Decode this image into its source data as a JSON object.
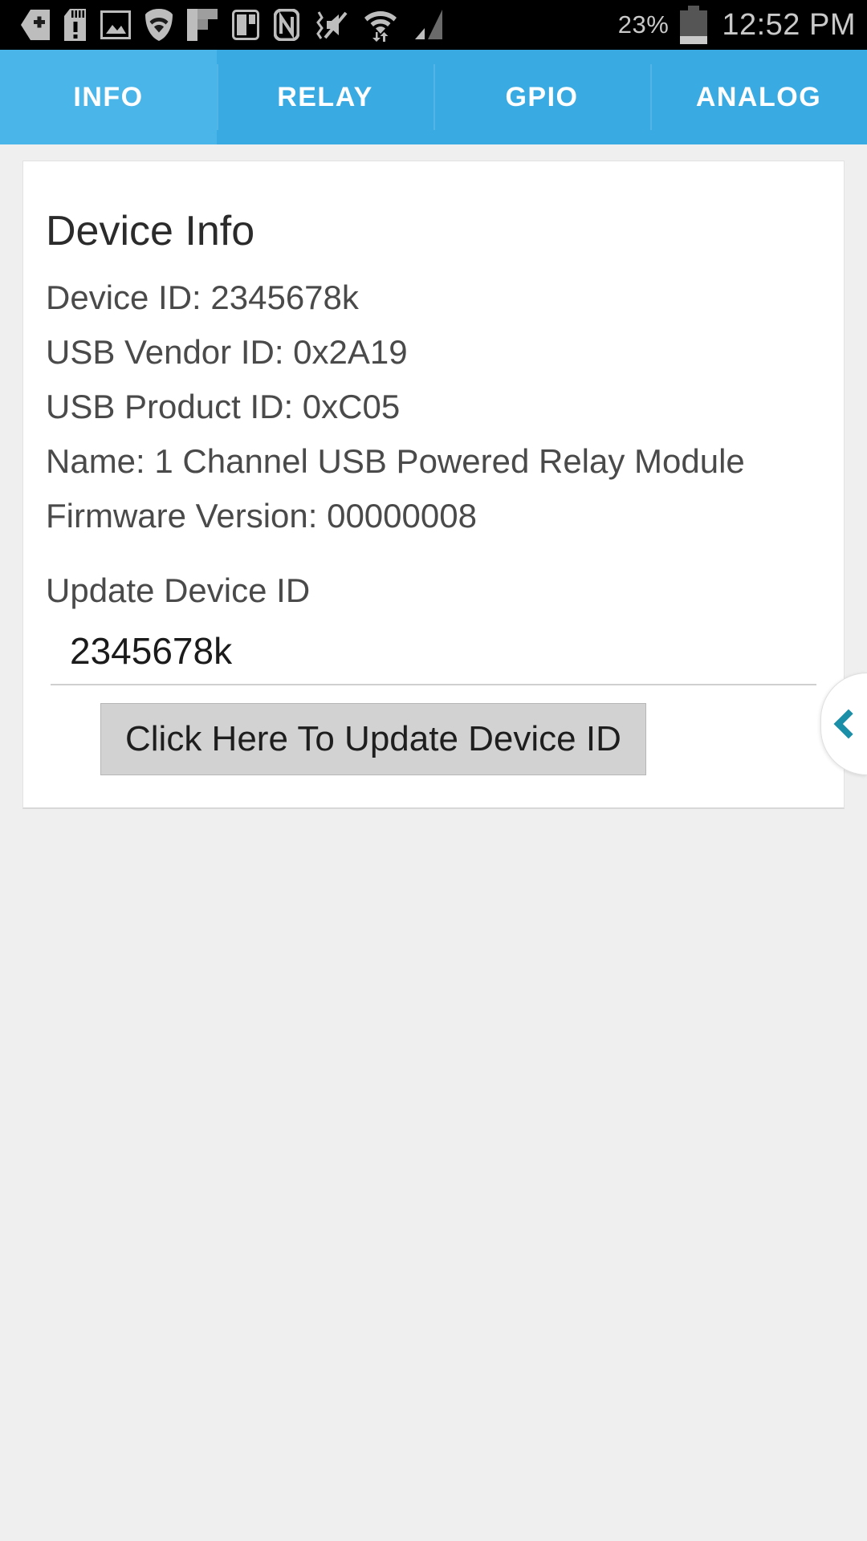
{
  "status_bar": {
    "icons": [
      "back-plus-icon",
      "sd-card-warning-icon",
      "image-icon",
      "wifi-shield-icon",
      "flipboard-icon",
      "split-screen-icon",
      "nfc-icon",
      "sound-muted-vibrate-icon",
      "wifi-data-transfer-icon",
      "cellular-signal-icon"
    ],
    "battery_percent": "23%",
    "battery_icon": "battery-icon",
    "time": "12:52 PM",
    "text_color": "#c9c9c9",
    "background": "#000000"
  },
  "tabs": {
    "active_index": 0,
    "active_color": "#4ab5e8",
    "inactive_color": "#3aabe2",
    "items": [
      {
        "label": "INFO"
      },
      {
        "label": "RELAY"
      },
      {
        "label": "GPIO"
      },
      {
        "label": "ANALOG"
      }
    ]
  },
  "card": {
    "title": "Device Info",
    "info_lines": [
      "Device ID: 2345678k",
      "USB Vendor ID: 0x2A19",
      "USB Product ID: 0xC05",
      "Name: 1 Channel USB Powered Relay Module",
      "Firmware Version: 00000008"
    ],
    "update_label": "Update Device ID",
    "device_id_input": {
      "value": "2345678k",
      "placeholder": "2345678k"
    },
    "update_button": "Click Here To Update Device ID"
  },
  "side_tab": {
    "icon": "chevron-left-icon",
    "accent_color": "#1b8ea8"
  }
}
